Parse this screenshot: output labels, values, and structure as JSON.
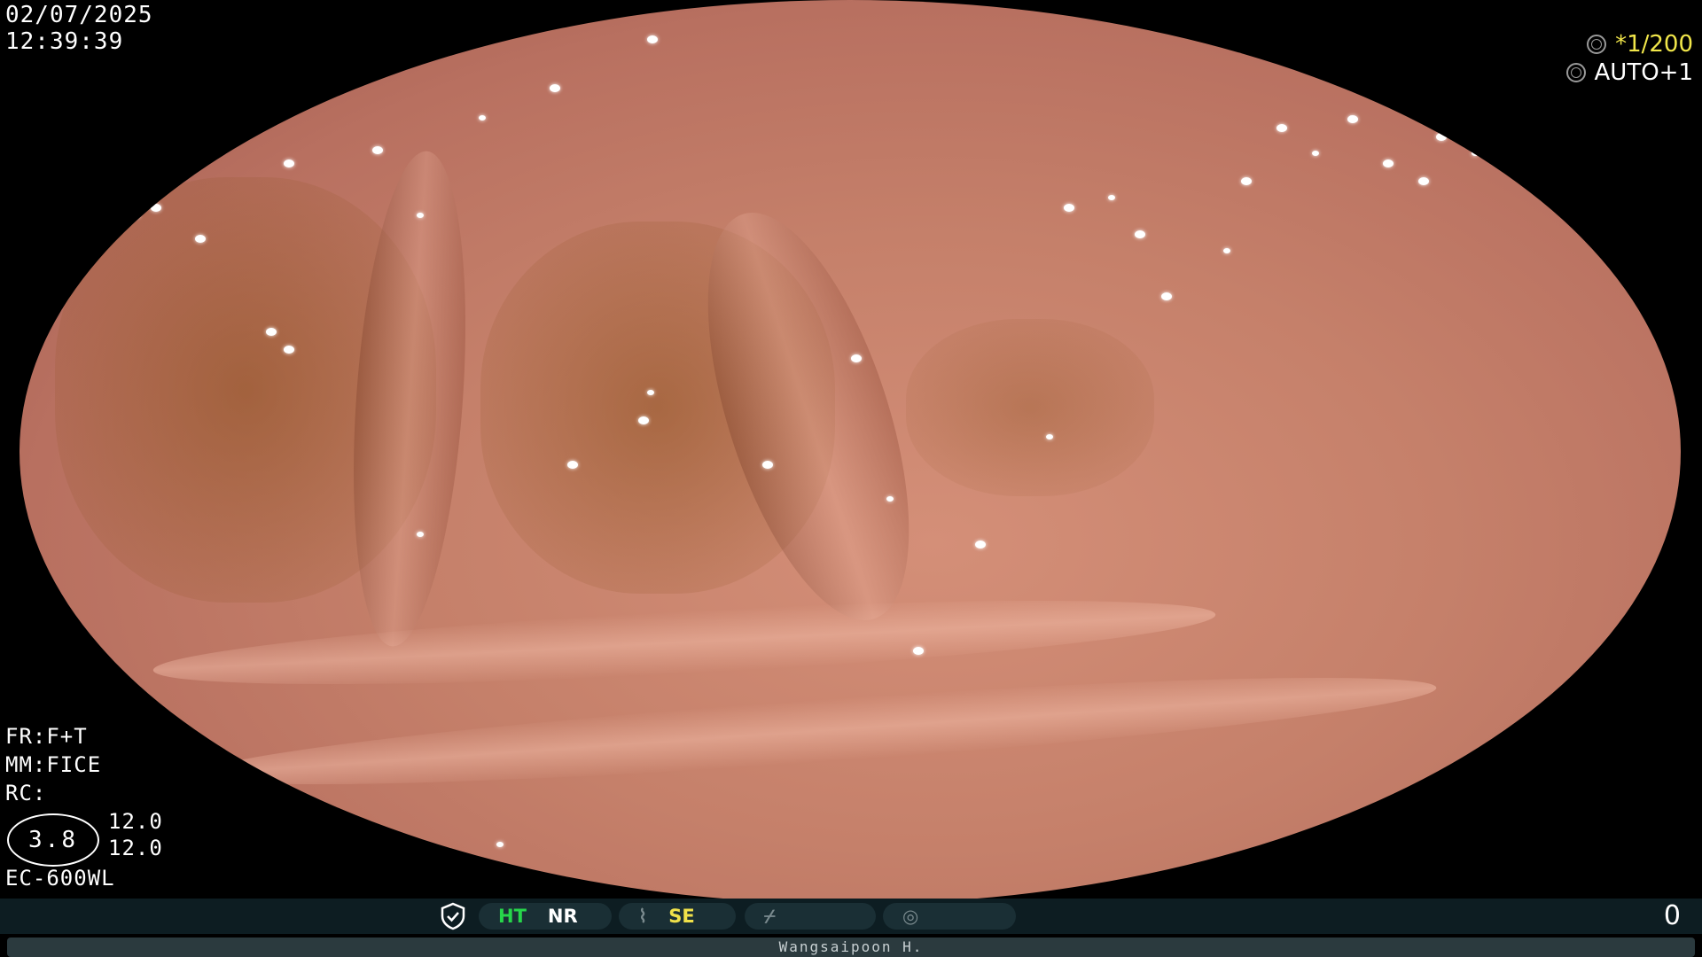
{
  "overlay": {
    "date": "02/07/2025",
    "time": "12:39:39",
    "shutter": "*1/200",
    "exposure": "AUTO+1",
    "fr": "FR:F+T",
    "mm": "MM:FICE",
    "rc": "RC:",
    "ratio": "3.8",
    "value_1": "12.0",
    "value_2": "12.0",
    "scope_model": "EC-600WL"
  },
  "statusbar": {
    "ht": "HT",
    "nr": "NR",
    "se": "SE",
    "counter": "0"
  },
  "operator": "Wangsaipoon H.",
  "colors": {
    "ht": "#27d54a",
    "se": "#f0e14a",
    "shutter": "#f1e64a",
    "statusbar_bg": "#0d1d22"
  },
  "icons": [
    "shutter-icon",
    "exposure-icon",
    "shield-icon",
    "structure-enhance-icon",
    "lightning-icon",
    "signal-icon"
  ]
}
